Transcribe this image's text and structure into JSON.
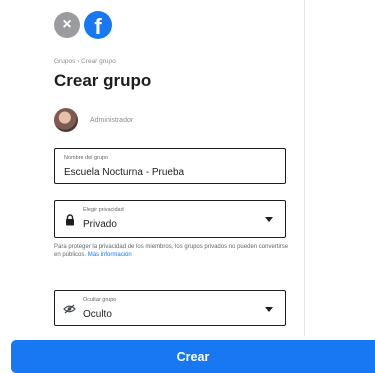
{
  "header": {
    "close_icon": "close-icon",
    "logo": "facebook-logo"
  },
  "breadcrumb": "Grupos › Crear grupo",
  "title": "Crear grupo",
  "admin": {
    "role_label": "Administrador"
  },
  "form": {
    "name_field": {
      "label": "Nombre del grupo",
      "value": "Escuela Nocturna - Prueba"
    },
    "privacy_field": {
      "label": "Elegir privacidad",
      "value": "Privado",
      "icon": "lock-icon"
    },
    "privacy_help": {
      "text": "Para proteger la privacidad de los miembros, los grupos privados no pueden convertirse en públicos. ",
      "link": "Más información"
    },
    "visibility_field": {
      "label": "Ocultar grupo",
      "value": "Oculto",
      "icon": "eye-off-icon"
    }
  },
  "actions": {
    "create_label": "Crear"
  },
  "colors": {
    "primary": "#1877f2",
    "text": "#1c1e21",
    "secondary_text": "#65676b",
    "close_button": "#9a9ca0"
  }
}
